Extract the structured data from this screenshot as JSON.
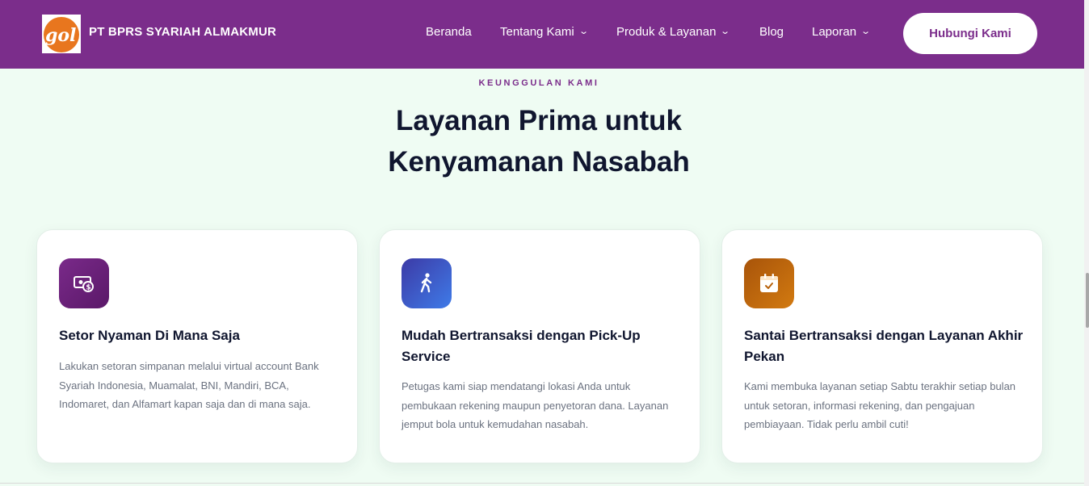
{
  "header": {
    "brand_name": "PT BPRS SYARIAH ALMAKMUR",
    "logo_text": "gol",
    "nav": [
      {
        "label": "Beranda",
        "dropdown": false
      },
      {
        "label": "Tentang Kami",
        "dropdown": true
      },
      {
        "label": "Produk & Layanan",
        "dropdown": true
      },
      {
        "label": "Blog",
        "dropdown": false
      },
      {
        "label": "Laporan",
        "dropdown": true
      }
    ],
    "cta_label": "Hubungi Kami"
  },
  "section": {
    "eyebrow": "KEUNGGULAN KAMI",
    "title_line1": "Layanan Prima untuk",
    "title_line2": "Kenyamanan Nasabah"
  },
  "cards": [
    {
      "icon": "money-deposit-icon",
      "title": "Setor Nyaman Di Mana Saja",
      "description": "Lakukan setoran simpanan melalui virtual account Bank Syariah Indonesia, Muamalat, BNI, Mandiri, BCA, Indomaret, dan Alfamart kapan saja dan di mana saja."
    },
    {
      "icon": "walking-person-icon",
      "title": "Mudah Bertransaksi dengan Pick-Up Service",
      "description": "Petugas kami siap mendatangi lokasi Anda untuk pembukaan rekening maupun penyetoran dana. Layanan jemput bola untuk kemudahan nasabah."
    },
    {
      "icon": "calendar-check-icon",
      "title": "Santai Bertransaksi dengan Layanan Akhir Pekan",
      "description": "Kami membuka layanan setiap Sabtu terakhir setiap bulan untuk setoran, informasi rekening, dan pengajuan pembiayaan. Tidak perlu ambil cuti!"
    }
  ],
  "colors": {
    "primary": "#7b2d8b",
    "background": "#effcf3",
    "heading": "#10162f",
    "icon_purple": "#6b1f7a",
    "icon_blue": "#3d5fd9",
    "icon_orange": "#c06808"
  }
}
